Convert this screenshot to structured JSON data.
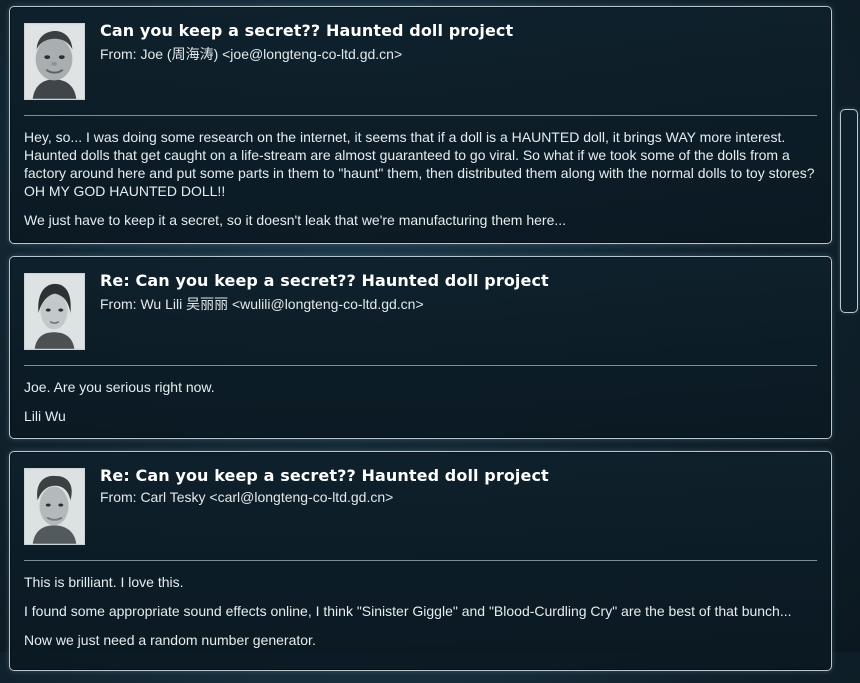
{
  "emails": [
    {
      "subject": "Can you keep a secret?? Haunted doll project",
      "from": "From: Joe (周海涛) <joe@longteng-co-ltd.gd.cn>",
      "avatar": "portrait-joe",
      "paragraphs": [
        "Hey, so... I was doing some research on the internet, it seems that if a doll is a HAUNTED doll, it brings WAY more interest. Haunted dolls that get caught on a life-stream are almost guaranteed to go viral. So what if we took some of the dolls from a factory around here and put some parts in them to \"haunt\" them, then distributed them along with the normal dolls to toy stores? OH MY GOD HAUNTED DOLL!!",
        "We just have to keep it a secret, so it doesn't leak that we're manufacturing them here..."
      ]
    },
    {
      "subject": "Re: Can you keep a secret?? Haunted doll project",
      "from": "From: Wu Lili 吴丽丽 <wulili@longteng-co-ltd.gd.cn>",
      "avatar": "portrait-wu-lili",
      "paragraphs": [
        "Joe. Are you serious right now.",
        "Lili Wu"
      ]
    },
    {
      "subject": "Re: Can you keep a secret?? Haunted doll project",
      "from": "From: Carl Tesky <carl@longteng-co-ltd.gd.cn>",
      "avatar": "portrait-carl-tesky",
      "paragraphs": [
        "This is brilliant. I love this.",
        "I found some appropriate sound effects online, I think \"Sinister Giggle\" and \"Blood-Curdling Cry\" are the best of that bunch...",
        "Now we just need a random number generator."
      ]
    }
  ],
  "colors": {
    "frame": "#b9c7cf",
    "background": "#11222d",
    "text": "#e6edf1"
  }
}
